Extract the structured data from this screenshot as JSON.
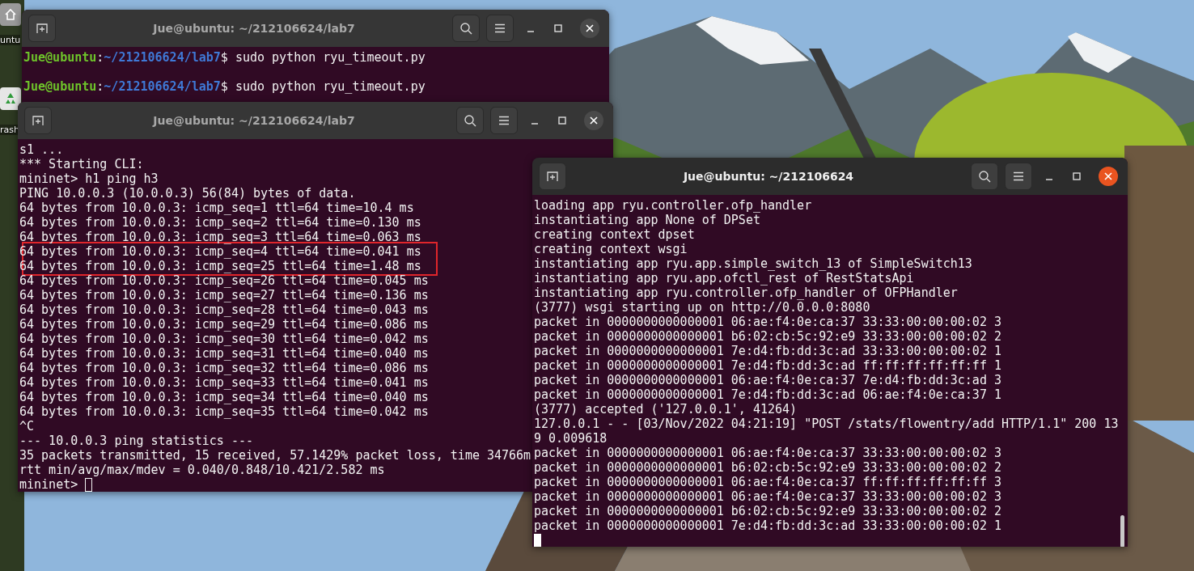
{
  "desktop": {
    "icons": [
      {
        "kind": "home",
        "label": "untu"
      },
      {
        "kind": "trash",
        "label": "rash"
      }
    ]
  },
  "windows": [
    {
      "title": "Jue@ubuntu: ~/212106624/lab7",
      "active": false,
      "lines": [
        {
          "kind": "prompt",
          "user": "Jue@ubuntu",
          "sep": ":",
          "path": "~/212106624/lab7",
          "command": "$ sudo python ryu_timeout.py"
        },
        {
          "kind": "blank"
        },
        {
          "kind": "prompt",
          "user": "Jue@ubuntu",
          "sep": ":",
          "path": "~/212106624/lab7",
          "command": "$ sudo python ryu_timeout.py"
        }
      ]
    },
    {
      "title": "Jue@ubuntu: ~/212106624/lab7",
      "active": false,
      "lines": [
        {
          "kind": "text",
          "text": "s1 ...",
          "highlighted": false
        },
        {
          "kind": "text",
          "text": "*** Starting CLI:",
          "highlighted": false
        },
        {
          "kind": "text",
          "text": "mininet> h1 ping h3",
          "highlighted": false
        },
        {
          "kind": "text",
          "text": "PING 10.0.0.3 (10.0.0.3) 56(84) bytes of data.",
          "highlighted": false
        },
        {
          "kind": "text",
          "text": "64 bytes from 10.0.0.3: icmp_seq=1 ttl=64 time=10.4 ms",
          "highlighted": false
        },
        {
          "kind": "text",
          "text": "64 bytes from 10.0.0.3: icmp_seq=2 ttl=64 time=0.130 ms",
          "highlighted": false
        },
        {
          "kind": "text",
          "text": "64 bytes from 10.0.0.3: icmp_seq=3 ttl=64 time=0.063 ms",
          "highlighted": false
        },
        {
          "kind": "text",
          "text": "64 bytes from 10.0.0.3: icmp_seq=4 ttl=64 time=0.041 ms",
          "highlighted": true
        },
        {
          "kind": "text",
          "text": "64 bytes from 10.0.0.3: icmp_seq=25 ttl=64 time=1.48 ms",
          "highlighted": true
        },
        {
          "kind": "text",
          "text": "64 bytes from 10.0.0.3: icmp_seq=26 ttl=64 time=0.045 ms",
          "highlighted": false
        },
        {
          "kind": "text",
          "text": "64 bytes from 10.0.0.3: icmp_seq=27 ttl=64 time=0.136 ms",
          "highlighted": false
        },
        {
          "kind": "text",
          "text": "64 bytes from 10.0.0.3: icmp_seq=28 ttl=64 time=0.043 ms",
          "highlighted": false
        },
        {
          "kind": "text",
          "text": "64 bytes from 10.0.0.3: icmp_seq=29 ttl=64 time=0.086 ms",
          "highlighted": false
        },
        {
          "kind": "text",
          "text": "64 bytes from 10.0.0.3: icmp_seq=30 ttl=64 time=0.042 ms",
          "highlighted": false
        },
        {
          "kind": "text",
          "text": "64 bytes from 10.0.0.3: icmp_seq=31 ttl=64 time=0.040 ms",
          "highlighted": false
        },
        {
          "kind": "text",
          "text": "64 bytes from 10.0.0.3: icmp_seq=32 ttl=64 time=0.086 ms",
          "highlighted": false
        },
        {
          "kind": "text",
          "text": "64 bytes from 10.0.0.3: icmp_seq=33 ttl=64 time=0.041 ms",
          "highlighted": false
        },
        {
          "kind": "text",
          "text": "64 bytes from 10.0.0.3: icmp_seq=34 ttl=64 time=0.040 ms",
          "highlighted": false
        },
        {
          "kind": "text",
          "text": "64 bytes from 10.0.0.3: icmp_seq=35 ttl=64 time=0.042 ms",
          "highlighted": false
        },
        {
          "kind": "text",
          "text": "^C",
          "highlighted": false
        },
        {
          "kind": "text",
          "text": "--- 10.0.0.3 ping statistics ---",
          "highlighted": false
        },
        {
          "kind": "text",
          "text": "35 packets transmitted, 15 received, 57.1429% packet loss, time 34766m",
          "highlighted": false
        },
        {
          "kind": "text",
          "text": "rtt min/avg/max/mdev = 0.040/0.848/10.421/2.582 ms",
          "highlighted": false
        },
        {
          "kind": "cursor",
          "text": "mininet> "
        }
      ]
    },
    {
      "title": "Jue@ubuntu: ~/212106624",
      "active": true,
      "lines": [
        {
          "kind": "text",
          "text": "loading app ryu.controller.ofp_handler",
          "highlighted": false
        },
        {
          "kind": "text",
          "text": "instantiating app None of DPSet",
          "highlighted": false
        },
        {
          "kind": "text",
          "text": "creating context dpset",
          "highlighted": false
        },
        {
          "kind": "text",
          "text": "creating context wsgi",
          "highlighted": false
        },
        {
          "kind": "text",
          "text": "instantiating app ryu.app.simple_switch_13 of SimpleSwitch13",
          "highlighted": false
        },
        {
          "kind": "text",
          "text": "instantiating app ryu.app.ofctl_rest of RestStatsApi",
          "highlighted": false
        },
        {
          "kind": "text",
          "text": "instantiating app ryu.controller.ofp_handler of OFPHandler",
          "highlighted": false
        },
        {
          "kind": "text",
          "text": "(3777) wsgi starting up on http://0.0.0.0:8080",
          "highlighted": false
        },
        {
          "kind": "text",
          "text": "packet in 0000000000000001 06:ae:f4:0e:ca:37 33:33:00:00:00:02 3",
          "highlighted": false
        },
        {
          "kind": "text",
          "text": "packet in 0000000000000001 b6:02:cb:5c:92:e9 33:33:00:00:00:02 2",
          "highlighted": false
        },
        {
          "kind": "text",
          "text": "packet in 0000000000000001 7e:d4:fb:dd:3c:ad 33:33:00:00:00:02 1",
          "highlighted": false
        },
        {
          "kind": "text",
          "text": "packet in 0000000000000001 7e:d4:fb:dd:3c:ad ff:ff:ff:ff:ff:ff 1",
          "highlighted": false
        },
        {
          "kind": "text",
          "text": "packet in 0000000000000001 06:ae:f4:0e:ca:37 7e:d4:fb:dd:3c:ad 3",
          "highlighted": false
        },
        {
          "kind": "text",
          "text": "packet in 0000000000000001 7e:d4:fb:dd:3c:ad 06:ae:f4:0e:ca:37 1",
          "highlighted": false
        },
        {
          "kind": "text",
          "text": "(3777) accepted ('127.0.0.1', 41264)",
          "highlighted": false
        },
        {
          "kind": "text",
          "text": "127.0.0.1 - - [03/Nov/2022 04:21:19] \"POST /stats/flowentry/add HTTP/1.1\" 200 13",
          "highlighted": false
        },
        {
          "kind": "text",
          "text": "9 0.009618",
          "highlighted": false
        },
        {
          "kind": "text",
          "text": "packet in 0000000000000001 06:ae:f4:0e:ca:37 33:33:00:00:00:02 3",
          "highlighted": false
        },
        {
          "kind": "text",
          "text": "packet in 0000000000000001 b6:02:cb:5c:92:e9 33:33:00:00:00:02 2",
          "highlighted": false
        },
        {
          "kind": "text",
          "text": "packet in 0000000000000001 06:ae:f4:0e:ca:37 ff:ff:ff:ff:ff:ff 3",
          "highlighted": false
        },
        {
          "kind": "text",
          "text": "packet in 0000000000000001 06:ae:f4:0e:ca:37 33:33:00:00:00:02 3",
          "highlighted": false
        },
        {
          "kind": "text",
          "text": "packet in 0000000000000001 b6:02:cb:5c:92:e9 33:33:00:00:00:02 2",
          "highlighted": false
        },
        {
          "kind": "text",
          "text": "packet in 0000000000000001 7e:d4:fb:dd:3c:ad 33:33:00:00:00:02 1",
          "highlighted": false
        },
        {
          "kind": "cursor"
        }
      ]
    }
  ]
}
